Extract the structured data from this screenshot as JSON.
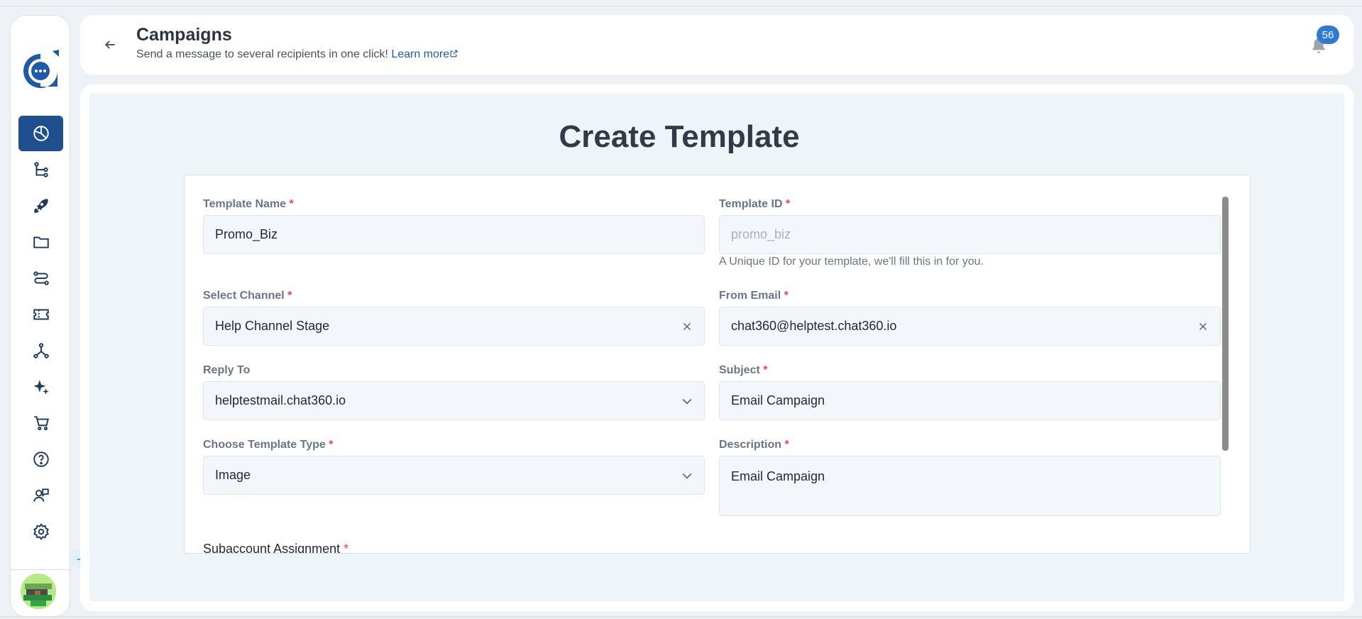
{
  "header": {
    "title": "Campaigns",
    "subtitle": "Send a message to several recipients in one click!",
    "learn_more": "Learn more",
    "notification_count": "56"
  },
  "sidebar": {
    "items": [
      {
        "icon": "analytics-pie-icon",
        "active": true
      },
      {
        "icon": "flow-tree-icon"
      },
      {
        "icon": "rocket-icon"
      },
      {
        "icon": "folder-icon"
      },
      {
        "icon": "route-icon"
      },
      {
        "icon": "ticket-icon"
      },
      {
        "icon": "network-icon"
      },
      {
        "icon": "sparkles-icon"
      },
      {
        "icon": "cart-icon"
      },
      {
        "icon": "help-circle-icon"
      },
      {
        "icon": "support-agent-icon"
      },
      {
        "icon": "settings-gear-icon"
      }
    ]
  },
  "form": {
    "title": "Create Template",
    "template_name": {
      "label": "Template Name",
      "value": "Promo_Biz"
    },
    "template_id": {
      "label": "Template ID",
      "placeholder": "promo_biz",
      "hint": "A Unique ID for your template, we'll fill this in for you."
    },
    "select_channel": {
      "label": "Select Channel",
      "value": "Help Channel Stage"
    },
    "from_email": {
      "label": "From Email",
      "value": "chat360@helptest.chat360.io"
    },
    "reply_to": {
      "label": "Reply To",
      "value": "helptestmail.chat360.io"
    },
    "subject": {
      "label": "Subject",
      "value": "Email Campaign"
    },
    "template_type": {
      "label": "Choose Template Type",
      "value": "Image"
    },
    "description": {
      "label": "Description",
      "value": "Email Campaign"
    },
    "subaccount_label": "Subaccount Assignment"
  },
  "colors": {
    "accent": "#1f4f8e",
    "link": "#1f5aa6",
    "badge": "#2e7ad1",
    "required": "#e5484d"
  }
}
